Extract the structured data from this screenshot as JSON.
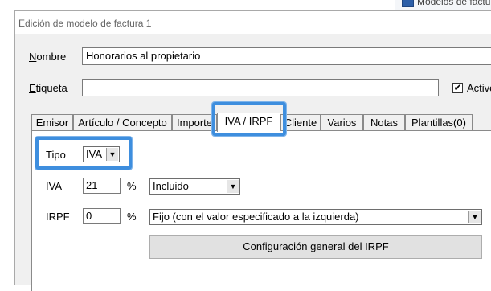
{
  "background_window": {
    "title": "Modelos de factu",
    "icon": "app-icon"
  },
  "dialog": {
    "title": "Edición de modelo de factura 1",
    "fields": {
      "nombre_label": "Nombre",
      "nombre_value": "Honorarios al propietario",
      "etiqueta_label": "Etiqueta",
      "etiqueta_value": "",
      "activo_label": "Activo",
      "activo_checked": true,
      "activo_mark": "✔"
    },
    "tabs": [
      {
        "label": "Emisor"
      },
      {
        "label": "Artículo / Concepto"
      },
      {
        "label": "Importe"
      },
      {
        "label": "IVA / IRPF",
        "active": true
      },
      {
        "label": "Cliente"
      },
      {
        "label": "Varios"
      },
      {
        "label": "Notas"
      },
      {
        "label": "Plantillas(0)"
      }
    ],
    "panel": {
      "tipo_label": "Tipo",
      "tipo_value": "IVA",
      "iva_label": "IVA",
      "iva_value": "21",
      "iva_percent": "%",
      "iva_mode": "Incluido",
      "irpf_label": "IRPF",
      "irpf_value": "0",
      "irpf_percent": "%",
      "irpf_mode": "Fijo (con el valor especificado a la izquierda)",
      "config_button": "Configuración general del IRPF"
    }
  },
  "colors": {
    "highlight": "#3e8ede",
    "dialog_bg": "#f0f0f0"
  }
}
